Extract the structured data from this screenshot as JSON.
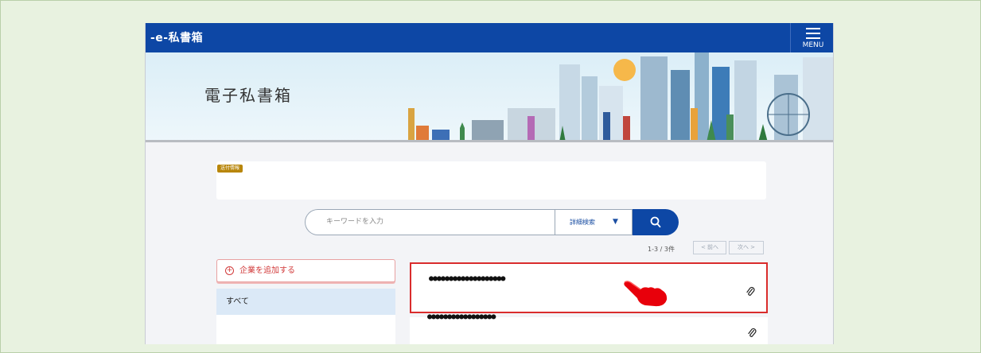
{
  "header": {
    "logo": "-e-私書箱",
    "menu_label": "MENU"
  },
  "hero": {
    "title": "電子私書箱"
  },
  "notice": {
    "label": "送付情報"
  },
  "search": {
    "placeholder": "キーワードを入力",
    "detail_label": "詳細検索",
    "detail_arrow": "▼"
  },
  "pager": {
    "count": "1-3 / 3件",
    "prev": "< 前へ",
    "next": "次へ >"
  },
  "sidebar": {
    "add_company": "企業を追加する",
    "add_icon": "+",
    "all_label": "すべて"
  },
  "mail_list": [
    {
      "sender": "●●●●●●●●●●●●●●●●●●●",
      "icon": "paperclip-icon"
    },
    {
      "sender": "●●●●●●●●●●●●●●●●●",
      "icon": "paperclip-icon"
    }
  ],
  "colors": {
    "header_blue": "#0d47a5",
    "highlight_red": "#d92c2c",
    "add_red": "#d23b3b",
    "notice_gold": "#b8860b",
    "background_green": "#e8f2e0"
  },
  "annotation": {
    "pointer_icon": "pointing-hand-icon"
  }
}
